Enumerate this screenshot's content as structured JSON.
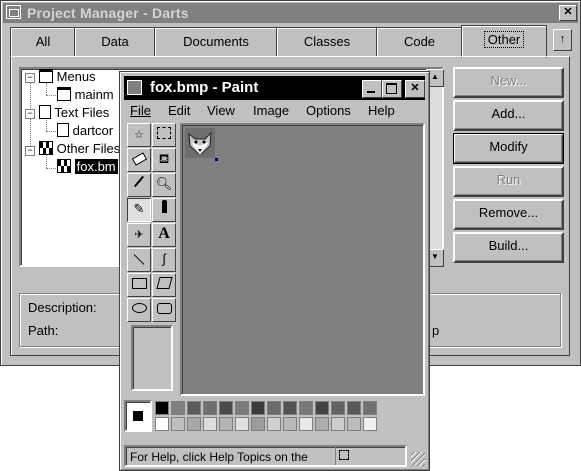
{
  "project_manager": {
    "title": "Project Manager - Darts",
    "close_glyph": "✕",
    "tabs": [
      "All",
      "Data",
      "Documents",
      "Classes",
      "Code",
      "Other"
    ],
    "selected_tab": "Other",
    "collapse_glyph": "↑",
    "tree": {
      "items": [
        {
          "label": "Menus"
        },
        {
          "label": "mainm"
        },
        {
          "label": "Text Files"
        },
        {
          "label": "dartcor"
        },
        {
          "label": "Other Files"
        },
        {
          "label": "fox.bm"
        }
      ]
    },
    "buttons": {
      "new": "New...",
      "add": "Add...",
      "modify": "Modify",
      "run": "Run",
      "remove": "Remove...",
      "build": "Build..."
    },
    "description_label": "Description:",
    "path_label": "Path:",
    "path_value_fragment": "p"
  },
  "paint": {
    "title": "fox.bmp - Paint",
    "menu": [
      "File",
      "Edit",
      "View",
      "Image",
      "Options",
      "Help"
    ],
    "status_text": "For Help, click Help Topics on the",
    "tools": [
      "free-select",
      "rect-select",
      "eraser",
      "fill",
      "color-picker",
      "magnifier",
      "pencil",
      "brush",
      "airbrush",
      "text",
      "line",
      "curve",
      "rectangle",
      "polygon",
      "ellipse",
      "rounded-rectangle"
    ],
    "text_tool_glyph": "A",
    "palette_top": [
      "#000000",
      "#808080",
      "#5a5a5a",
      "#6e6e6e",
      "#4a4a4a",
      "#7a7a7a",
      "#3c3c3c",
      "#6a6a6a",
      "#525252",
      "#787878",
      "#444444",
      "#626262",
      "#585858",
      "#707070"
    ],
    "palette_bottom": [
      "#ffffff",
      "#c0c0c0",
      "#a8a8a8",
      "#dcdcdc",
      "#b4b4b4",
      "#e0e0e0",
      "#9c9c9c",
      "#d0d0d0",
      "#b8b8b8",
      "#e8e8e8",
      "#acacac",
      "#cccccc",
      "#bcbcbc",
      "#f0f0f0"
    ]
  }
}
